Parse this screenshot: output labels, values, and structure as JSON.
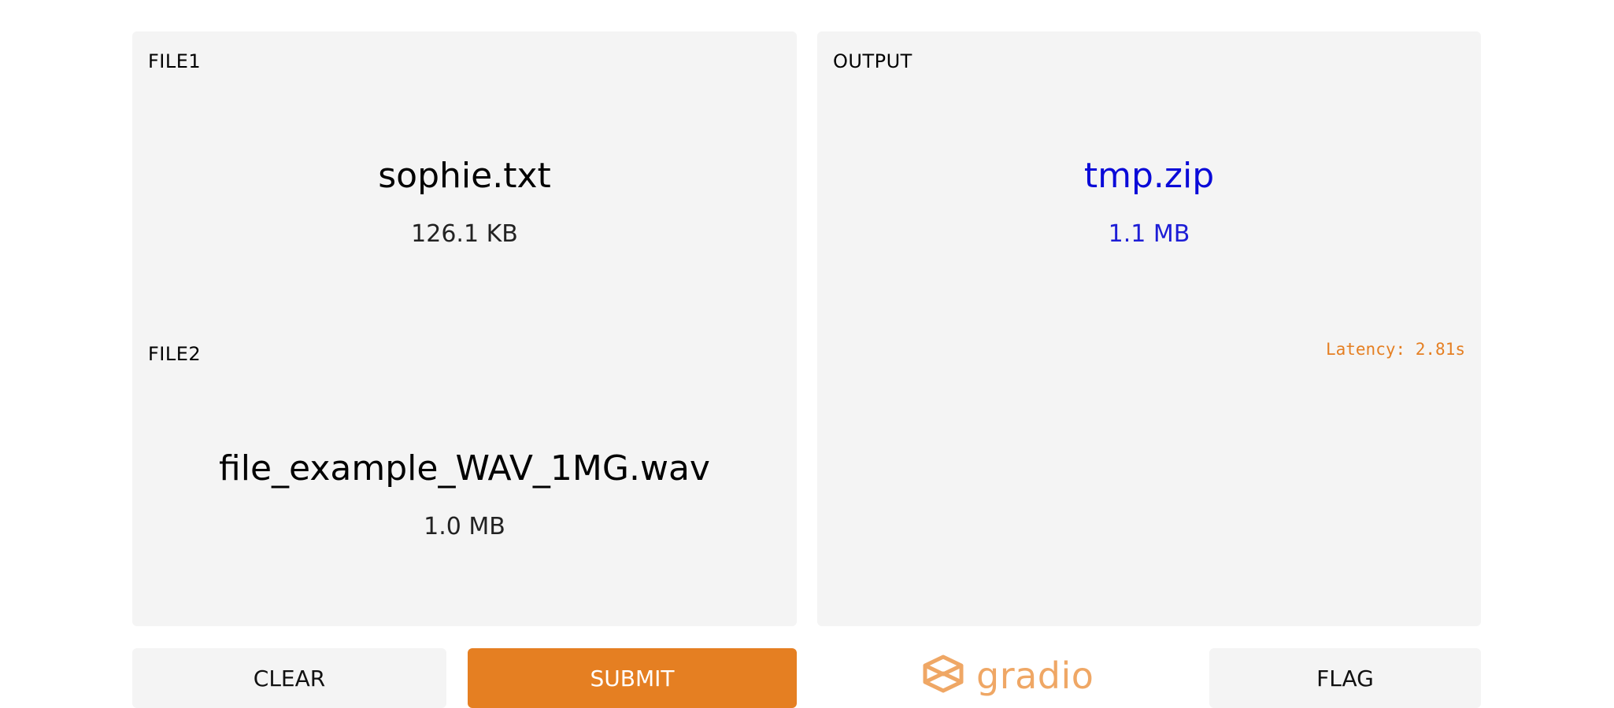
{
  "inputs": {
    "file1": {
      "label": "FILE1",
      "name": "sophie.txt",
      "size": "126.1 KB"
    },
    "file2": {
      "label": "FILE2",
      "name": "file_example_WAV_1MG.wav",
      "size": "1.0 MB"
    }
  },
  "output": {
    "label": "OUTPUT",
    "name": "tmp.zip",
    "size": "1.1 MB",
    "latency": "Latency: 2.81s"
  },
  "actions": {
    "clear_label": "CLEAR",
    "submit_label": "SUBMIT",
    "flag_label": "FLAG"
  },
  "brand": {
    "name": "gradio",
    "icon": "gradio-logo-icon"
  },
  "colors": {
    "accent": "#e57f22",
    "panel_bg": "#f4f4f4",
    "link_blue": "#0a0ad8"
  }
}
